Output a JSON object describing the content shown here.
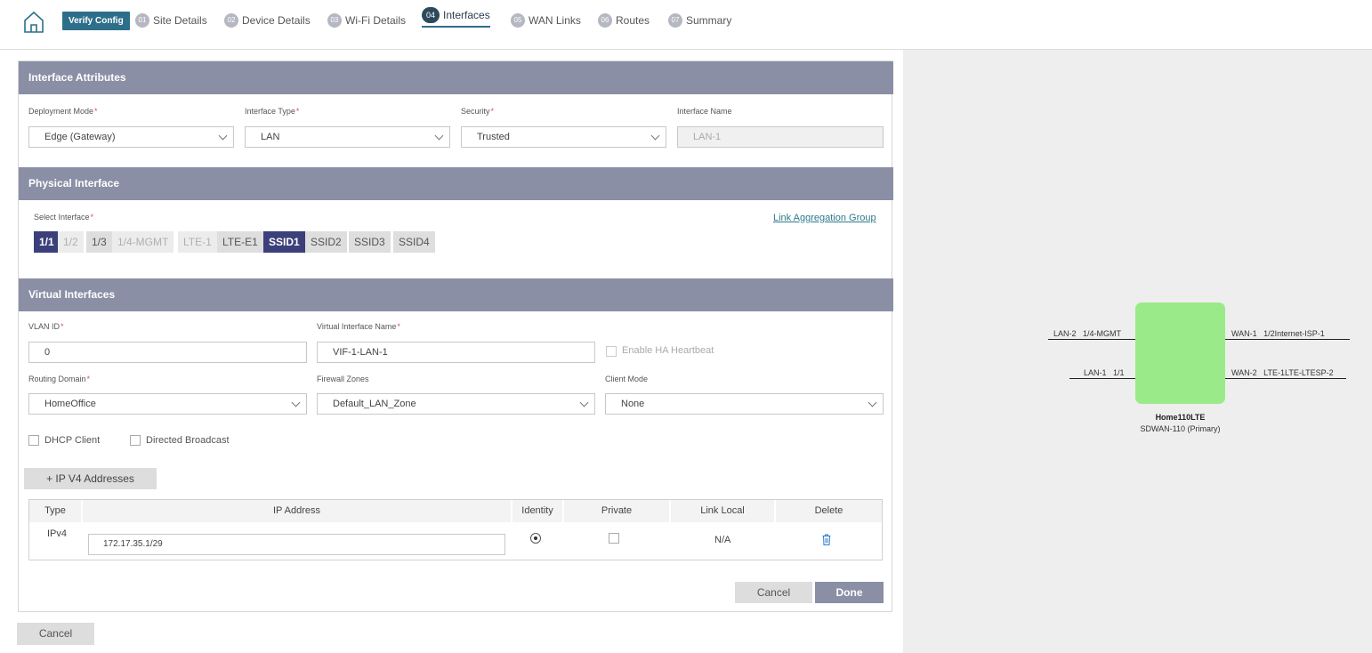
{
  "nav": {
    "verify_label": "Verify Config",
    "steps": [
      {
        "num": "01",
        "label": "Site Details"
      },
      {
        "num": "02",
        "label": "Device Details"
      },
      {
        "num": "03",
        "label": "Wi-Fi Details"
      },
      {
        "num": "04",
        "label": "Interfaces"
      },
      {
        "num": "05",
        "label": "WAN Links"
      },
      {
        "num": "06",
        "label": "Routes"
      },
      {
        "num": "07",
        "label": "Summary"
      }
    ],
    "active_step": "Interfaces"
  },
  "interface_attributes": {
    "title": "Interface Attributes",
    "deployment_mode": {
      "label": "Deployment Mode",
      "value": "Edge (Gateway)"
    },
    "interface_type": {
      "label": "Interface Type",
      "value": "LAN"
    },
    "security": {
      "label": "Security",
      "value": "Trusted"
    },
    "interface_name": {
      "label": "Interface Name",
      "value": "LAN-1"
    }
  },
  "physical_interface": {
    "title": "Physical Interface",
    "select_label": "Select Interface",
    "link_aggregation": "Link Aggregation Group",
    "chips": [
      "1/1",
      "1/2",
      "1/3",
      "1/4-MGMT",
      "LTE-1",
      "LTE-E1",
      "SSID1",
      "SSID2",
      "SSID3",
      "SSID4"
    ]
  },
  "virtual_interfaces": {
    "title": "Virtual Interfaces",
    "vlan_id": {
      "label": "VLAN ID",
      "value": "0"
    },
    "vif_name": {
      "label": "Virtual Interface Name",
      "value": "VIF-1-LAN-1"
    },
    "ha_heartbeat": "Enable HA Heartbeat",
    "routing_domain": {
      "label": "Routing Domain",
      "value": "HomeOffice"
    },
    "firewall_zones": {
      "label": "Firewall Zones",
      "value": "Default_LAN_Zone"
    },
    "client_mode": {
      "label": "Client Mode",
      "value": "None"
    },
    "dhcp_client": "DHCP Client",
    "directed_broadcast": "Directed Broadcast",
    "add_ipv4": "+ IP V4 Addresses",
    "table": {
      "headers": [
        "Type",
        "IP Address",
        "Identity",
        "Private",
        "Link Local",
        "Delete"
      ],
      "rows": [
        {
          "type": "IPv4",
          "ip": "172.17.35.1/29",
          "link_local": "N/A"
        }
      ]
    },
    "cancel": "Cancel",
    "done": "Done"
  },
  "footer": {
    "cancel": "Cancel"
  },
  "diagram": {
    "device_name": "Home110LTE",
    "device_model": "SDWAN-110 (Primary)",
    "color": "#9aea8a",
    "ports_left": [
      "LAN-2   1/4-MGMT",
      "LAN-1   1/1"
    ],
    "ports_right": [
      "WAN-1   1/2Internet-ISP-1",
      "WAN-2   LTE-1LTE-LTESP-2"
    ]
  }
}
